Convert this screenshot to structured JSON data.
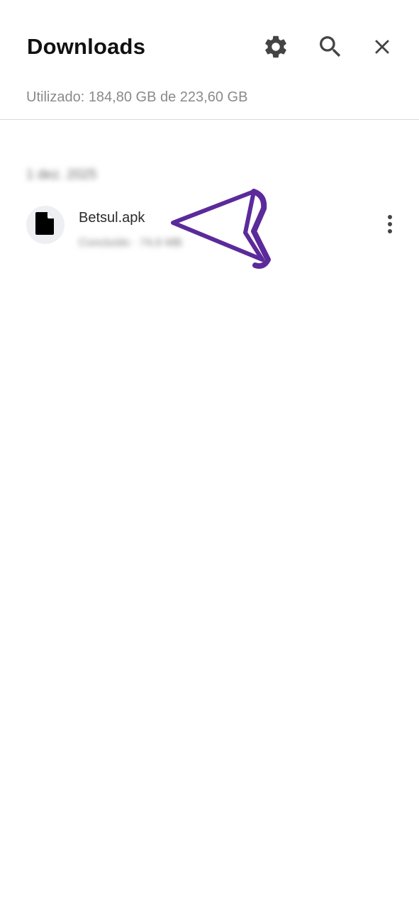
{
  "header": {
    "title": "Downloads",
    "settings_icon": "gear-icon",
    "search_icon": "search-icon",
    "close_icon": "close-icon"
  },
  "storage": {
    "text": "Utilizado: 184,80 GB de 223,60 GB"
  },
  "downloads": {
    "date_group": "1 dez. 2025",
    "items": [
      {
        "file_name": "Betsul.apk",
        "meta": "Concluído · 74,6 MB",
        "icon": "file-icon",
        "menu_icon": "more-vertical-icon"
      }
    ]
  },
  "colors": {
    "annotation": "#5b2a9b",
    "icon_gray": "#444444",
    "storage_text": "#8a8a8a",
    "file_icon_bg": "#eeeff3"
  }
}
